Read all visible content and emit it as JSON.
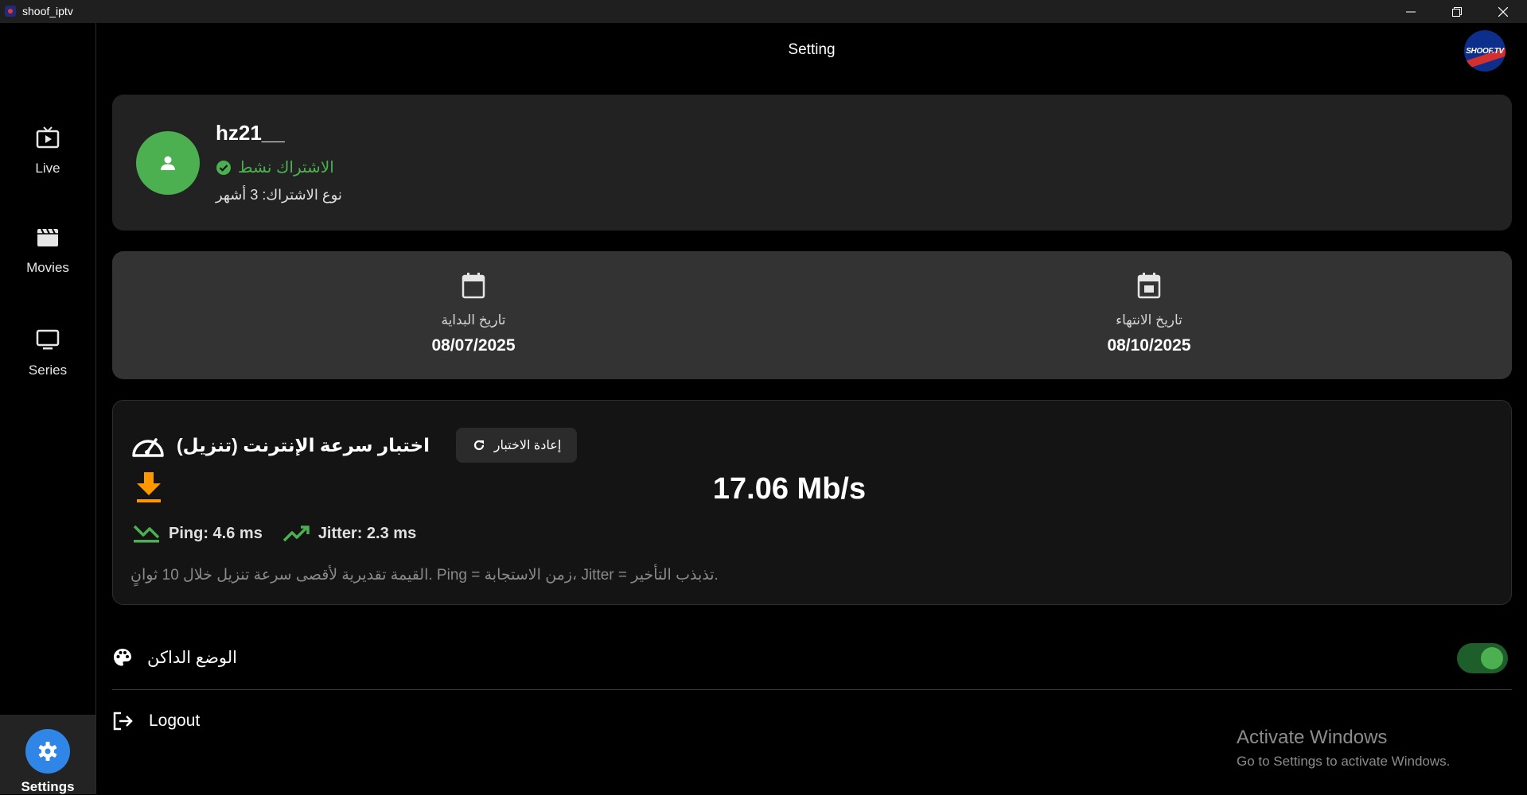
{
  "window": {
    "title": "shoof_iptv"
  },
  "sidebar": {
    "items": [
      {
        "label": "Live",
        "icon": "live-tv-icon"
      },
      {
        "label": "Movies",
        "icon": "movie-clapper-icon"
      },
      {
        "label": "Series",
        "icon": "monitor-icon"
      },
      {
        "label": "Settings",
        "icon": "gear-icon",
        "active": true
      }
    ]
  },
  "header": {
    "title": "Setting",
    "logo_text": "SHOOF.TV"
  },
  "profile": {
    "username": "hz21__",
    "status": "الاشتراك نشط",
    "subscription_type": "نوع الاشتراك: 3 أشهر"
  },
  "dates": {
    "start_label": "تاريخ البداية",
    "start_value": "08/07/2025",
    "end_label": "تاريخ الانتهاء",
    "end_value": "08/10/2025"
  },
  "speed_test": {
    "title": "اختبار سرعة الإنترنت (تنزيل)",
    "retest_label": "إعادة الاختبار",
    "speed": "17.06 Mb/s",
    "ping": "Ping: 4.6 ms",
    "jitter": "Jitter: 2.3 ms",
    "note": "القيمة تقديرية لأقصى سرعة تنزيل خلال 10 ثوانٍ. Ping = زمن الاستجابة، Jitter = تذبذب التأخير."
  },
  "settings": {
    "dark_mode_label": "الوضع الداكن",
    "dark_mode_on": true,
    "logout_label": "Logout"
  },
  "watermark": {
    "line1": "Activate Windows",
    "line2": "Go to Settings to activate Windows."
  },
  "colors": {
    "accent_green": "#4caf50",
    "accent_blue": "#2f86e6",
    "accent_orange": "#ff9800"
  }
}
